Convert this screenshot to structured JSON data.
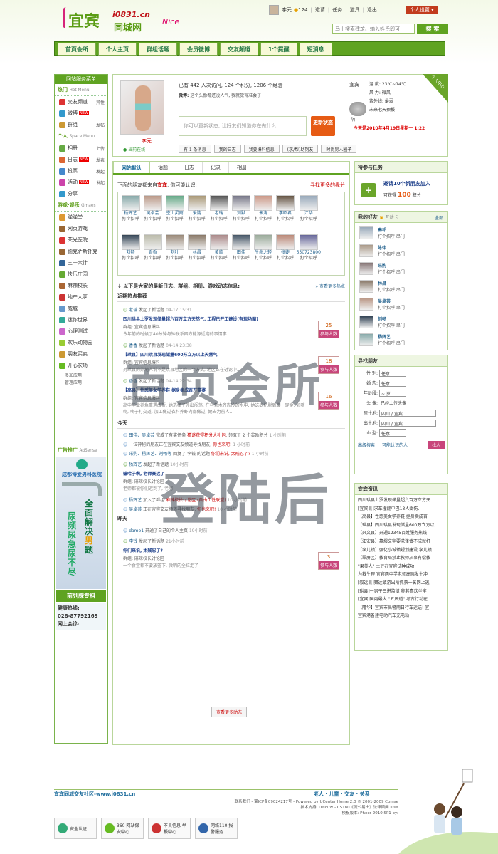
{
  "brand": {
    "logo_main": "宜宾",
    "logo_domain": "i0831.cn",
    "logo_sub": "同城网",
    "logo_deco": "Nice"
  },
  "topbar": {
    "username": "李元",
    "points": "124",
    "links": [
      "邀请",
      "任务",
      "道具",
      "退出"
    ],
    "settings": "个人设置 ▾"
  },
  "search": {
    "placeholder": "马上搜索建筑、输入姓氏即可!",
    "button": "搜 索"
  },
  "nav": [
    "首页会所",
    "个人主页",
    "群组话题",
    "会员微博",
    "交友频道",
    "1个提醒",
    "短消息"
  ],
  "sidebar": {
    "head": "网站服务菜单",
    "hot_title": "热门",
    "hot_en": "Hot Menu",
    "hot_items": [
      {
        "label": "交友频道",
        "extra": "异性",
        "color": "#d33"
      },
      {
        "label": "微博",
        "extra": "",
        "hot": "NEW",
        "color": "#39c"
      },
      {
        "label": "群组",
        "extra": "发帖",
        "color": "#c93"
      }
    ],
    "space_title": "个人",
    "space_en": "Space Menu",
    "space_items": [
      {
        "label": "相册",
        "extra": "上传",
        "color": "#6a4"
      },
      {
        "label": "日志",
        "extra": "发表",
        "hot": "NEW",
        "color": "#d63"
      },
      {
        "label": "投票",
        "extra": "发起",
        "color": "#48c"
      },
      {
        "label": "活动",
        "extra": "发起",
        "hot": "NEW",
        "color": "#c4a"
      },
      {
        "label": "分享",
        "extra": "",
        "color": "#39c"
      }
    ],
    "game_title": "游戏·娱乐",
    "game_en": "Gmaes",
    "game_items": [
      {
        "label": "弹弹堂",
        "color": "#d93"
      },
      {
        "label": "网页游戏",
        "color": "#963"
      },
      {
        "label": "荣光医院",
        "color": "#d33"
      },
      {
        "label": "德克萨斯扑克",
        "color": "#963"
      },
      {
        "label": "三十六计",
        "color": "#369"
      },
      {
        "label": "快乐庄园",
        "color": "#6a3"
      },
      {
        "label": "麻辣校长",
        "color": "#a63"
      },
      {
        "label": "地产大亨",
        "color": "#c33"
      },
      {
        "label": "威城",
        "color": "#69c"
      },
      {
        "label": "迷你世界",
        "color": "#3a9"
      },
      {
        "label": "心理测试",
        "color": "#c6c"
      },
      {
        "label": "欢乐动物园",
        "color": "#9c3"
      },
      {
        "label": "朋友买卖",
        "color": "#c93"
      },
      {
        "label": "开心农场",
        "color": "#6b2"
      }
    ],
    "small_items": [
      "多加应用",
      "管理应用"
    ],
    "ad_title": "广告推广",
    "ad_en": "AdSense",
    "ad": {
      "hospital": "成都博爱男科医院",
      "slogan_left": "尿频尿急尿不尽",
      "slogan_right_top": "全面解决",
      "slogan_right_key": "男",
      "slogan_right_bottom": "题",
      "bar": "前列腺专科",
      "hotline_label": "健康热线:",
      "hotline": "028-87792169",
      "web_label": "网上会诊:"
    }
  },
  "profile": {
    "name": "李元",
    "online": "当前在线",
    "stats": "已有 442 人次访问, 124 个积分, 1206 个经验",
    "sign_label": "微博:",
    "sign_text": "这个头像都还没人气, 我就觉得准会了",
    "status_placeholder": "你可以更新状态, 让好友们知道你在做什么……",
    "status_button": "更新状态",
    "buttons": [
      "有 1 条消息",
      "我的日志",
      "我要爆料信息",
      "(求/帮)助列友",
      "时尚男人圈子"
    ],
    "weather_city": "宜宾",
    "weather_lines": [
      "温 度: 23℃~14℃",
      "风 力: 微风",
      "紫外线: 最弱",
      "未来七天预报"
    ],
    "weather_label": "阴",
    "date": "今天是2010年4月19日星期一 1:22",
    "ribbon": "个人中心"
  },
  "feed": {
    "tabs": [
      "网站默认",
      "话题",
      "日志",
      "记录",
      "相册"
    ],
    "friends_intro_a": "下面的朋友都来自",
    "friends_intro_city": "宜宾",
    "friends_intro_b": ", 你可能认识:",
    "friends_more": "寻找更多的缘分",
    "friends": [
      {
        "name": "杨辉艺",
        "act": "打个招呼",
        "c": "#8aa"
      },
      {
        "name": "吴卓芸",
        "act": "打个招呼",
        "c": "#b98"
      },
      {
        "name": "空山灵雨",
        "act": "打个招呼",
        "c": "#6a8"
      },
      {
        "name": "采购",
        "act": "打个招呼",
        "c": "#a97"
      },
      {
        "name": "老瑞",
        "act": "打个招呼",
        "c": "#555"
      },
      {
        "name": "刘默",
        "act": "打个招呼",
        "c": "#778"
      },
      {
        "name": "朱涛",
        "act": "打个招呼",
        "c": "#c98"
      },
      {
        "name": "李昭君",
        "act": "打个招呼",
        "c": "#654"
      },
      {
        "name": "江华",
        "act": "打个招呼",
        "c": "#9ab"
      },
      {
        "name": "",
        "act": "",
        "c": "#fff"
      },
      {
        "name": "刘畅",
        "act": "打个招呼",
        "c": "#345"
      },
      {
        "name": "香香",
        "act": "打个招呼",
        "c": "#bba"
      },
      {
        "name": "刘叶",
        "act": "打个招呼",
        "c": "#987"
      },
      {
        "name": "林昌",
        "act": "打个招呼",
        "c": "#876"
      },
      {
        "name": "黄欣",
        "act": "打个招呼",
        "c": "#a88"
      },
      {
        "name": "田伟",
        "act": "打个招呼",
        "c": "#456"
      },
      {
        "name": "生命之轻",
        "act": "打个招呼",
        "c": "#9a9"
      },
      {
        "name": "张婕",
        "act": "打个招呼",
        "c": "#b87"
      },
      {
        "name": "550723800",
        "act": "打个招呼",
        "c": "#669"
      },
      {
        "name": "",
        "act": "",
        "c": "#fff"
      }
    ],
    "feed_title": "↓ 以下是大家的最新日志、群组、相册、游戏动态信息:",
    "feed_more": "» 查看更多热点",
    "hot_title": "近期热点推荐",
    "entries": [
      {
        "who": "老瑞",
        "what": "发起了新话题",
        "time": "04-17 15:31",
        "title": "四川珙县上罗发现储量超六百万立方天然气, 工程已开工建设(有现场图)",
        "group": "群组: 宜宾信息爆料",
        "desc": "今年前的时候了40分钟与钟联系四方能源近期的事情事",
        "count": "25",
        "join": "参与人数"
      },
      {
        "who": "香香",
        "what": "发起了新话题",
        "time": "04-14 23:38",
        "title": "【珙县】四川珙县发现储量600万立方以上天然气",
        "group": "群组: 宜宾信息爆料",
        "desc": "对珙县的外地人说不是珙县地区的一个方式, 地区正在讨论中...",
        "count": "18",
        "join": "参与人数"
      },
      {
        "who": "香香",
        "what": "发起了新话题",
        "time": "04-14 22:34",
        "title": "【高县】性感美女学养鞋 据身卖成百万富婆",
        "group": "群组: 宜宾信息爆料",
        "desc": "高中毕业养鱼重遇故折, 她选择了外出闯荡, 在乌鲁木齐冻冷的水中, 她选衣把脱到脚一穿金: 卯嘀吻, 嘀子打交道, 加工做过衣料养虾肉都做过, 她去为前人…",
        "count": "16",
        "join": "参与人数"
      }
    ],
    "today": "今天",
    "minis": [
      {
        "who": "田伟、吴卓芸",
        "what": "完成了有奖任务",
        "target": "猜谜获得积分大礼包",
        "tail": ", 领取了 2 个奖励积分",
        "time": "1 小时前"
      },
      {
        "who": "",
        "what": "一位神秘的朋友正在宜宾交友频道寻找朋友,",
        "target": "你也来吧!",
        "tail": "",
        "time": "1 小时前"
      },
      {
        "who": "采购、杨辉艺、刘畅等",
        "what": "回复了 李钱 的话题",
        "target": "你们来说, 太残忍了?",
        "tail": "",
        "time": "1 小时前"
      }
    ],
    "entry2": {
      "who": "杨辉艺",
      "what": "发起了新话题",
      "time": "10小时前",
      "title": "骗哈子啊, 老师赛迟了",
      "group": "群组: 麻辣校长讨论区",
      "desc": "老师都被你们迟到了, 老啊"
    },
    "minis2": [
      {
        "who": "杨辉艺",
        "what": "加入了群组",
        "target": "麻辣校长讨论区 (自由个性联盟)",
        "time": "10 小时前"
      },
      {
        "who": "吴卓芸",
        "what": "正在宜宾交友频道寻找朋友,",
        "target": "你也来吧!",
        "time": "10 小时前"
      }
    ],
    "yesterday": "昨天",
    "mini3": {
      "who": "damo1",
      "what": "开通了自己的个人主页",
      "time": "19小时前"
    },
    "entry3": {
      "who": "李钱",
      "what": "发起了新话题",
      "time": "21小时前",
      "title": "你们来说, 太残忍了?",
      "group": "群组: 麻辣校长讨论区",
      "desc": "一个食堂都不要放签下, 微明的全拉走了",
      "count": "3",
      "join": "参与人数"
    },
    "load_more": "查看更多动态"
  },
  "task": {
    "title": "待参与任务",
    "task_name": "邀请10个新朋友加入",
    "reward_label": "可获得",
    "reward": "100",
    "reward_unit": "积分"
  },
  "myfriends": {
    "title": "我的好友",
    "title_sub": "互动卡",
    "all": "全部",
    "items": [
      {
        "name": "秦祁",
        "act": "打个招呼  串门",
        "c": "#9ab"
      },
      {
        "name": "陈伟",
        "act": "打个招呼  串门",
        "c": "#a98"
      },
      {
        "name": "采购",
        "act": "打个招呼  串门",
        "c": "#877"
      },
      {
        "name": "林昌",
        "act": "打个招呼  串门",
        "c": "#876"
      },
      {
        "name": "吴卓芸",
        "act": "打个招呼  串门",
        "c": "#b98"
      },
      {
        "name": "刘畅",
        "act": "打个招呼  串门",
        "c": "#345"
      },
      {
        "name": "杨辉艺",
        "act": "打个招呼  串门",
        "c": "#8aa"
      }
    ]
  },
  "findfriend": {
    "title": "寻找朋友",
    "rows": [
      {
        "label": "性 别:",
        "value": "任意"
      },
      {
        "label": "婚 恋:",
        "value": "任意"
      },
      {
        "label": "年龄段:",
        "value": "~  岁"
      },
      {
        "label": "头 像:",
        "value": "已经上传头像"
      },
      {
        "label": "居住地:",
        "value": "四川 / 宜宾"
      },
      {
        "label": "出生地:",
        "value": "四川 / 宜宾"
      },
      {
        "label": "血 型:",
        "value": "任意"
      }
    ],
    "advanced": "高级搜索",
    "maybe": "可能认识的人",
    "go": "找人"
  },
  "news": {
    "title": "宜宾资讯",
    "items": [
      "四川珙县上罗发现储量超六百万立方天",
      "[宜宾县]求车撞翻中巴13人受伤.",
      "【高县】性感美女学养鞋 据身卖成百",
      "【珙县】四川珙县发现储量600万立方以",
      "【兴文县】开通12345百姓服务热线",
      "【江安县】靠爆文字要求谨慎不成就打",
      "【李儿镇】强化小城镇规划建设 李儿镇",
      "【翠屏区】教育局禁止教师从事有偿教",
      "\"果美人\" 土豆在宜宾试种成功",
      "为救生理 宜宾两中学老师高赌发生冲",
      "[叙远县]舞达镇游出所抓获一名网上逃",
      "[珙县]一男子三进监狱 称其喜欢坐牢",
      "[宜宾]国内最大 \"五尺道\" 考古行动在",
      "【隆华】宜宾市民警雨日行车运送! 宜",
      "宜宾港备建电动汽车充电站"
    ]
  },
  "footer": {
    "site": "宜宾同城交友社区-www.i0831.cn",
    "links": "老人 · 儿童 · 交友 · 关系",
    "copy1": "联系我们 - 蜀ICP备09024217号 - Powered by UCenter Home 2.0 © 2001-2009 Comsenz Inc.",
    "copy2": "技术支持: Discuz! - CS180《流公易士》法律顾问 IIIse-注新城",
    "copy3": "模板版本: Pheer 2010 SP1 by: 吴晖侦"
  },
  "badges": [
    {
      "label": "安全认证",
      "c": "#3a7"
    },
    {
      "label": "360 网站保安中心",
      "c": "#6b2"
    },
    {
      "label": "不良信息 举报中心",
      "c": "#c33"
    },
    {
      "label": "网络110 报警服务",
      "c": "#36a"
    }
  ],
  "watermark": {
    "line1": "百页会所",
    "line2": "登陆后"
  }
}
